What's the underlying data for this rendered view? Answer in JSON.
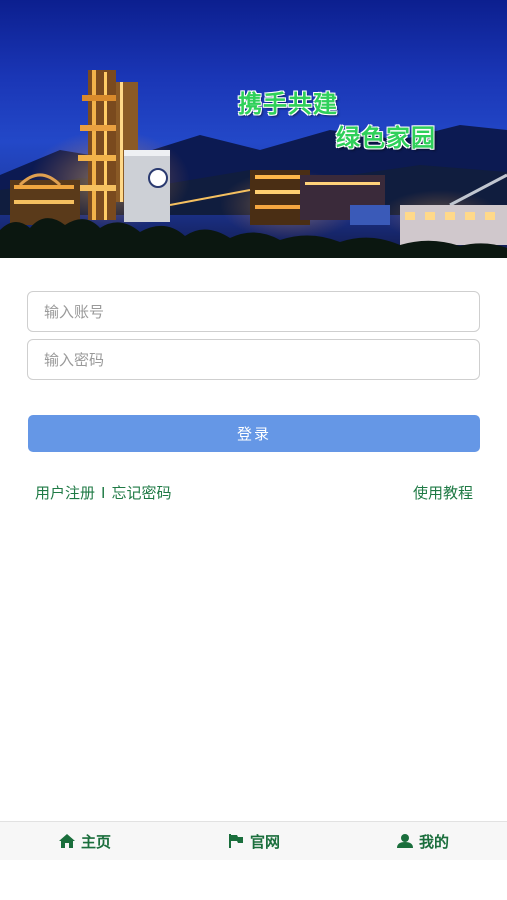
{
  "banner": {
    "slogan_line1": "携手共建",
    "slogan_line2": "绿色家园"
  },
  "form": {
    "account_placeholder": "输入账号",
    "password_placeholder": "输入密码",
    "login_label": "登录"
  },
  "links": {
    "register": "用户注册",
    "separator": "I",
    "forgot": "忘记密码",
    "tutorial": "使用教程"
  },
  "nav": {
    "items": [
      {
        "label": "主页",
        "icon": "home-icon"
      },
      {
        "label": "官网",
        "icon": "flag-icon"
      },
      {
        "label": "我的",
        "icon": "user-icon"
      }
    ]
  },
  "colors": {
    "accent": "#6597e6",
    "link_green": "#1f7a45",
    "nav_green": "#1a6e3c",
    "slogan_green": "#2fd05a"
  }
}
